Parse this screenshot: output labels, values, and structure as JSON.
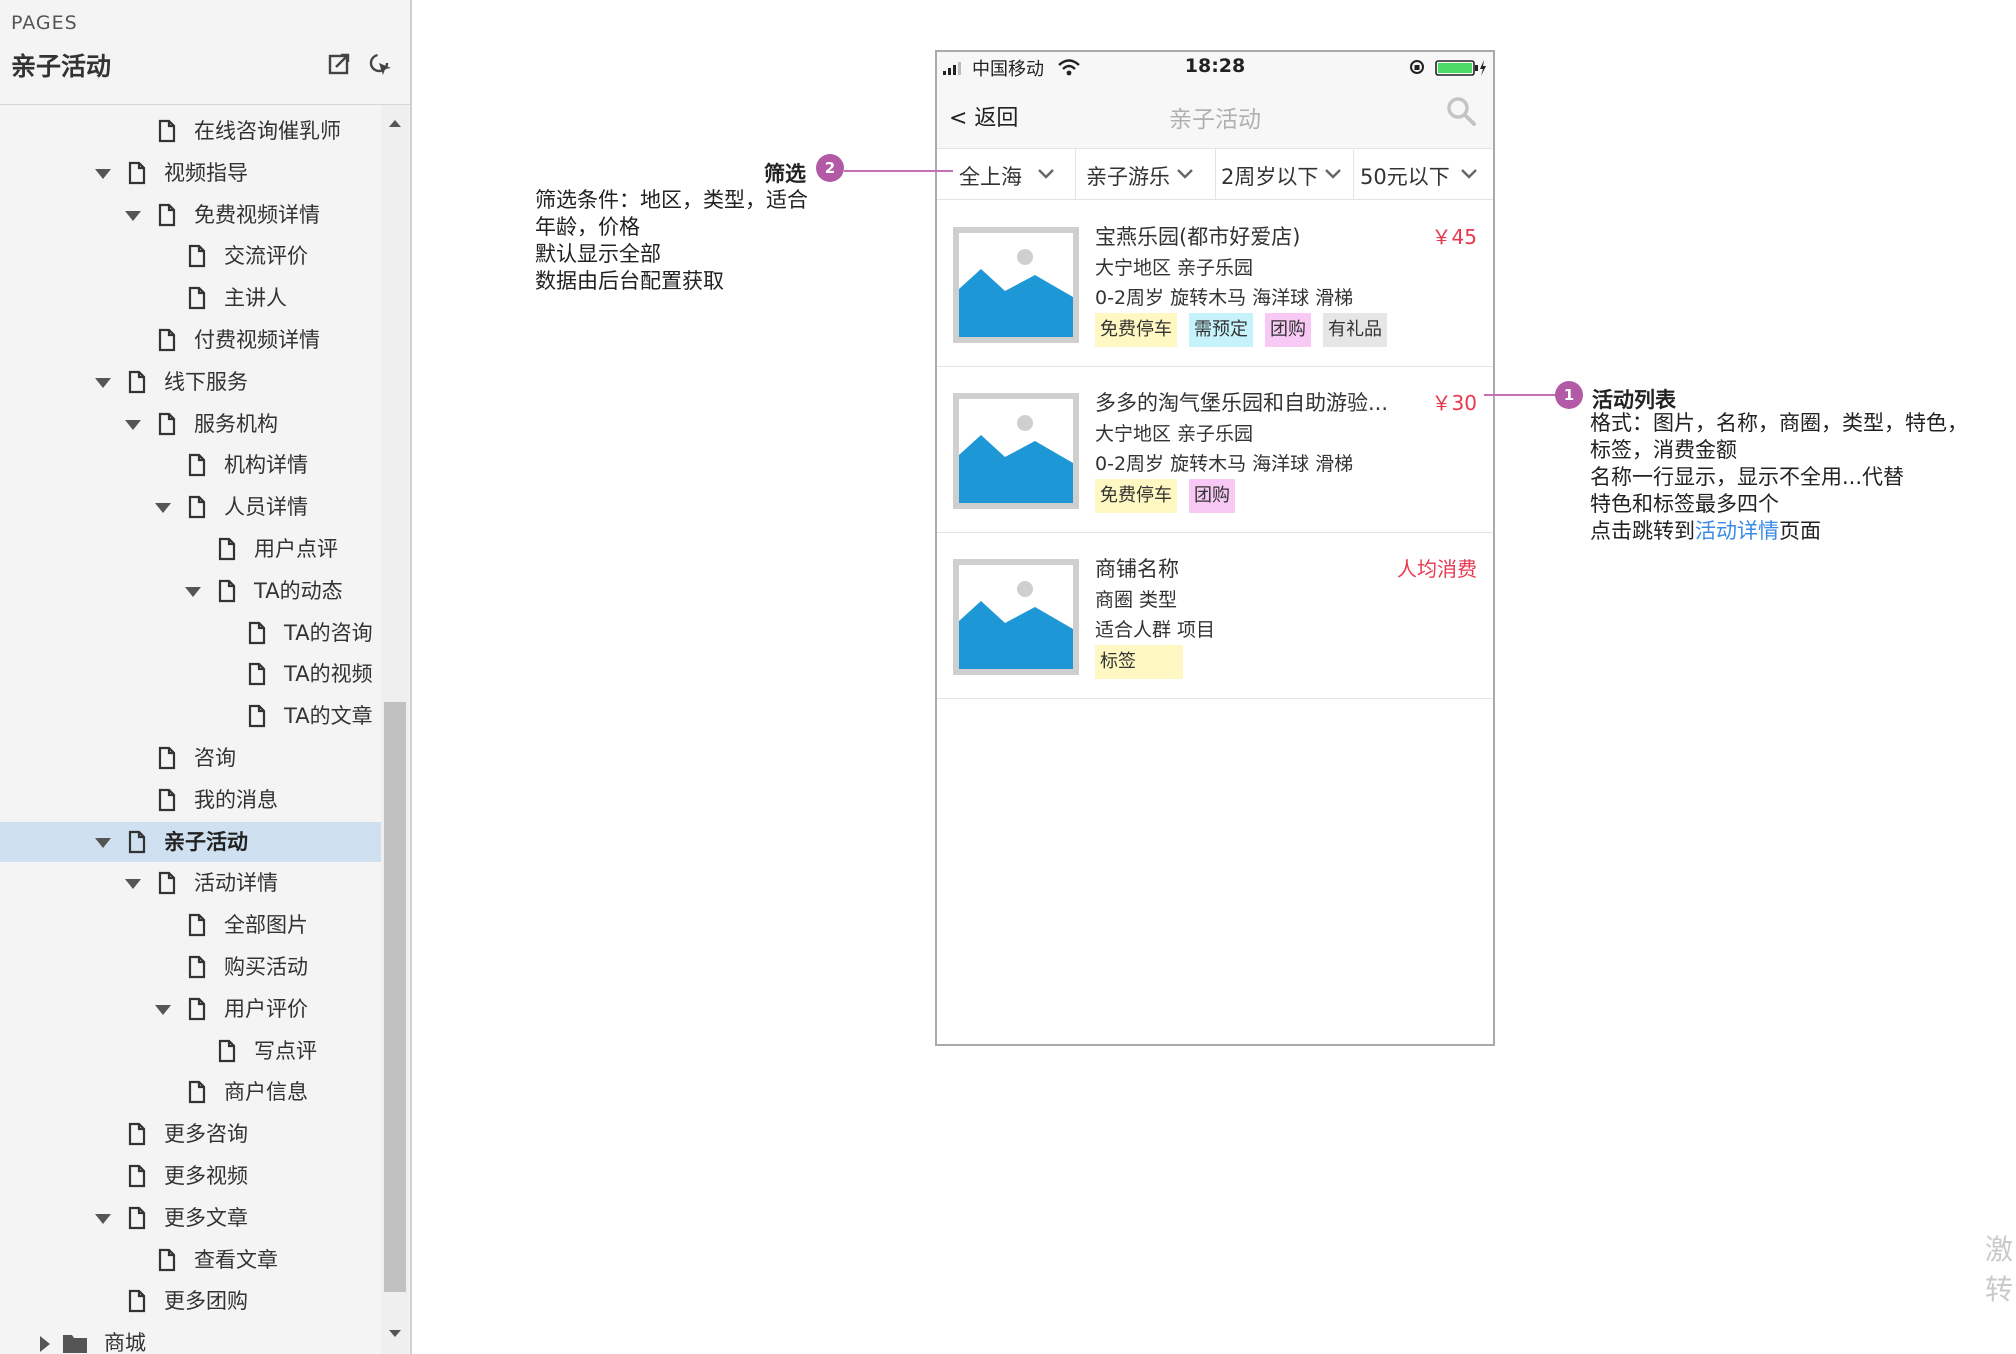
{
  "sidebar": {
    "pages_label": "PAGES",
    "project_title": "亲子活动",
    "tree": [
      {
        "label": "在线咨询催乳师",
        "depth": 2,
        "arrow": "none",
        "type": "page"
      },
      {
        "label": "视频指导",
        "depth": 1,
        "arrow": "down",
        "type": "page"
      },
      {
        "label": "免费视频详情",
        "depth": 2,
        "arrow": "down",
        "type": "page"
      },
      {
        "label": "交流评价",
        "depth": 3,
        "arrow": "none",
        "type": "page"
      },
      {
        "label": "主讲人",
        "depth": 3,
        "arrow": "none",
        "type": "page"
      },
      {
        "label": "付费视频详情",
        "depth": 2,
        "arrow": "none",
        "type": "page"
      },
      {
        "label": "线下服务",
        "depth": 1,
        "arrow": "down",
        "type": "page"
      },
      {
        "label": "服务机构",
        "depth": 2,
        "arrow": "down",
        "type": "page"
      },
      {
        "label": "机构详情",
        "depth": 3,
        "arrow": "none",
        "type": "page"
      },
      {
        "label": "人员详情",
        "depth": 3,
        "arrow": "down",
        "type": "page"
      },
      {
        "label": "用户点评",
        "depth": 4,
        "arrow": "none",
        "type": "page"
      },
      {
        "label": "TA的动态",
        "depth": 4,
        "arrow": "down",
        "type": "page"
      },
      {
        "label": "TA的咨询",
        "depth": 5,
        "arrow": "none",
        "type": "page"
      },
      {
        "label": "TA的视频",
        "depth": 5,
        "arrow": "none",
        "type": "page"
      },
      {
        "label": "TA的文章",
        "depth": 5,
        "arrow": "none",
        "type": "page"
      },
      {
        "label": "咨询",
        "depth": 2,
        "arrow": "none",
        "type": "page"
      },
      {
        "label": "我的消息",
        "depth": 2,
        "arrow": "none",
        "type": "page"
      },
      {
        "label": "亲子活动",
        "depth": 1,
        "arrow": "down",
        "type": "page",
        "selected": true
      },
      {
        "label": "活动详情",
        "depth": 2,
        "arrow": "down",
        "type": "page"
      },
      {
        "label": "全部图片",
        "depth": 3,
        "arrow": "none",
        "type": "page"
      },
      {
        "label": "购买活动",
        "depth": 3,
        "arrow": "none",
        "type": "page"
      },
      {
        "label": "用户评价",
        "depth": 3,
        "arrow": "down",
        "type": "page"
      },
      {
        "label": "写点评",
        "depth": 4,
        "arrow": "none",
        "type": "page"
      },
      {
        "label": "商户信息",
        "depth": 3,
        "arrow": "none",
        "type": "page"
      },
      {
        "label": "更多咨询",
        "depth": 1,
        "arrow": "none",
        "type": "page"
      },
      {
        "label": "更多视频",
        "depth": 1,
        "arrow": "none",
        "type": "page"
      },
      {
        "label": "更多文章",
        "depth": 1,
        "arrow": "down",
        "type": "page"
      },
      {
        "label": "查看文章",
        "depth": 2,
        "arrow": "none",
        "type": "page"
      },
      {
        "label": "更多团购",
        "depth": 1,
        "arrow": "none",
        "type": "page"
      },
      {
        "label": "商城",
        "depth": 0,
        "arrow": "right",
        "type": "folder"
      }
    ]
  },
  "phone": {
    "status": {
      "carrier": "中国移动",
      "time": "18:28"
    },
    "nav": {
      "back": "< 返回",
      "title": "亲子活动"
    },
    "filters": [
      "全上海",
      "亲子游乐",
      "2周岁以下",
      "50元以下"
    ],
    "items": [
      {
        "name": "宝燕乐园(都市好爱店)",
        "price": "￥45",
        "area": "大宁地区  亲子乐园",
        "features": "0-2周岁 旋转木马 海洋球 滑梯",
        "tags": [
          {
            "label": "免费停车",
            "color": "yellow"
          },
          {
            "label": "需预定",
            "color": "cyan"
          },
          {
            "label": "团购",
            "color": "pink"
          },
          {
            "label": "有礼品",
            "color": "gray"
          }
        ]
      },
      {
        "name": "多多的淘气堡乐园和自助游验...",
        "price": "￥30",
        "area": "大宁地区  亲子乐园",
        "features": "0-2周岁 旋转木马 海洋球 滑梯",
        "tags": [
          {
            "label": "免费停车",
            "color": "yellow"
          },
          {
            "label": "团购",
            "color": "pink"
          }
        ]
      },
      {
        "name": "商铺名称",
        "price": "人均消费",
        "area": "商圈  类型",
        "features": "适合人群 项目",
        "tags": [
          {
            "label": "标签",
            "color": "yellow",
            "wide": true
          }
        ]
      }
    ]
  },
  "annotations": {
    "filter": {
      "badge": "2",
      "title": "筛选",
      "lines": [
        "筛选条件：地区，类型，适合",
        "年龄，价格",
        "默认显示全部",
        "数据由后台配置获取"
      ]
    },
    "list": {
      "badge": "1",
      "title": "活动列表",
      "lines": [
        "格式：图片，名称，商圈，类型，特色，",
        "标签，消费金额",
        "名称一行显示，显示不全用...代替",
        "特色和标签最多四个"
      ],
      "last_line_prefix": "点击跳转到",
      "last_line_link": "活动详情",
      "last_line_suffix": "页面"
    }
  },
  "corner_text": [
    "激",
    "转"
  ],
  "colors": {
    "price_red": "#e8384f",
    "annotation_purple": "#b25aa6",
    "link_blue": "#3a8be6",
    "selected_row": "#cfe1f0"
  }
}
